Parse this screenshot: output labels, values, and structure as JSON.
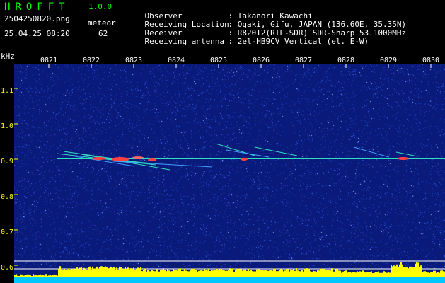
{
  "header": {
    "app_title": "HROFFT",
    "app_version": "1.0.0",
    "file_name": "2504250820.png",
    "meteor_label": "meteor",
    "date_time": "25.04.25 08:20",
    "meteor_count": "62"
  },
  "station": [
    {
      "key": "Observer",
      "value": "Takanori Kawachi"
    },
    {
      "key": "Receiving Location",
      "value": "Ogaki, Gifu, JAPAN (136.60E, 35.35N)"
    },
    {
      "key": "Receiver",
      "value": "R820T2(RTL-SDR) SDR-Sharp 53.1000MHz"
    },
    {
      "key": "Receiving antenna",
      "value": "2el-HB9CV Vertical (el. E-W)"
    }
  ],
  "axis": {
    "y_unit": "kHz",
    "y_ticks": [
      "1.1",
      "1.0",
      "0.9",
      "0.8",
      "0.7",
      "0.6"
    ],
    "x_ticks": [
      "0821",
      "0822",
      "0823",
      "0824",
      "0825",
      "0826",
      "0827",
      "0828",
      "0829",
      "0830"
    ]
  },
  "colors": {
    "background": "#000000",
    "spectrogram_bg": "#0a1a7a",
    "noise": "#3a6cff",
    "carrier": "#30e0c0",
    "meteor_hot": "#ff4040",
    "level_bar": "#ffff00",
    "baseline": "#00c8ff",
    "label_yellow": "#ffff00",
    "label_green": "#00ff00"
  }
}
